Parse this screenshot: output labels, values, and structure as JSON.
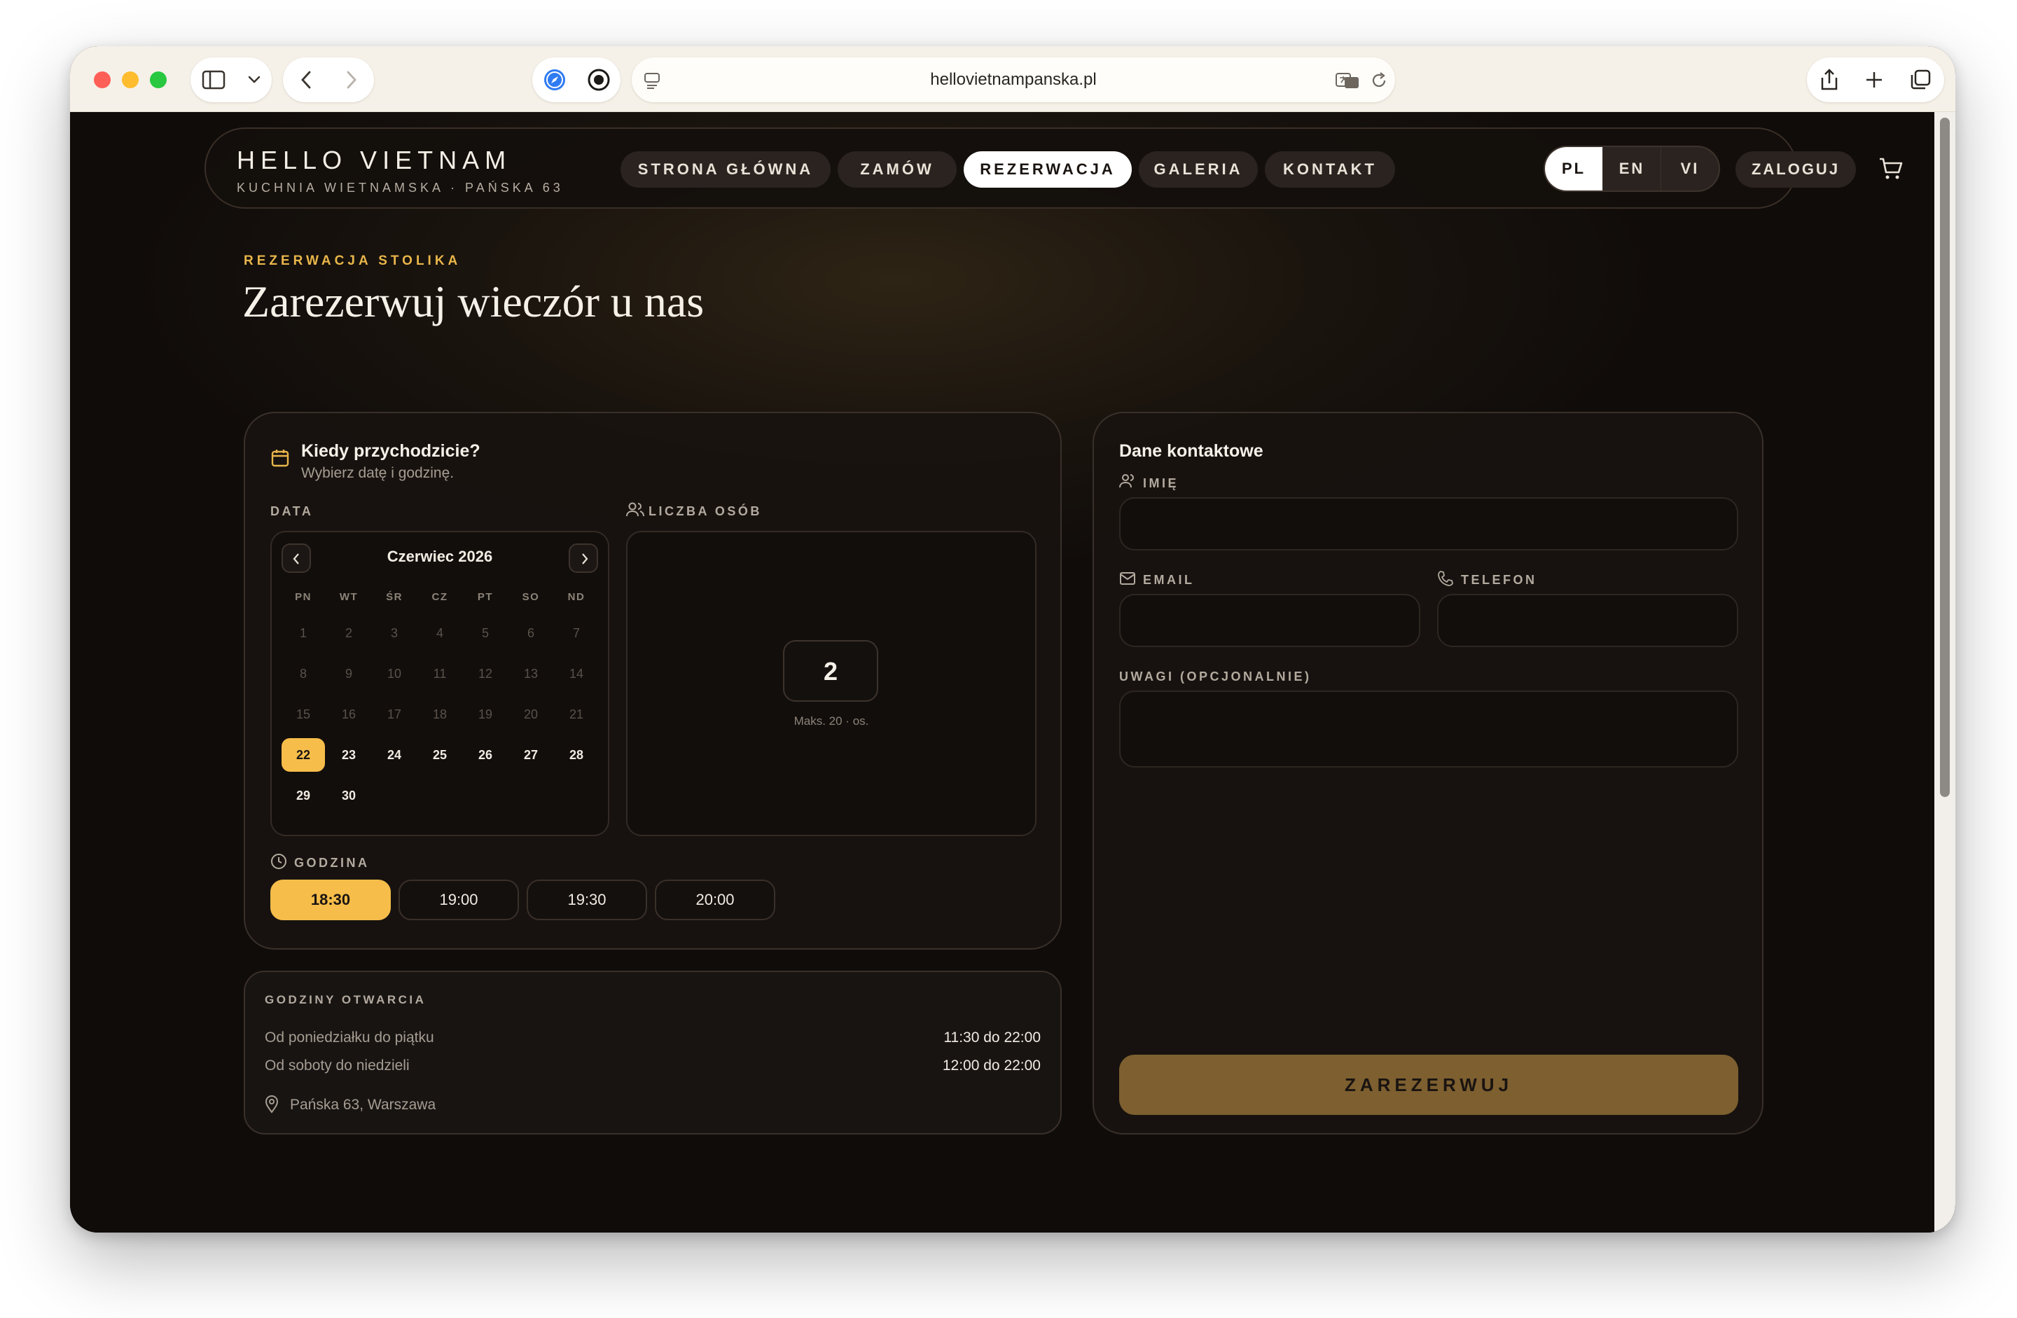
{
  "browser": {
    "url": "hellovietnampanska.pl"
  },
  "brand": {
    "name": "HELLO VIETNAM",
    "tagline": "KUCHNIA WIETNAMSKA · PAŃSKA 63"
  },
  "nav": {
    "items": [
      {
        "label": "STRONA GŁÓWNA",
        "active": false
      },
      {
        "label": "ZAMÓW",
        "active": false
      },
      {
        "label": "REZERWACJA",
        "active": true
      },
      {
        "label": "GALERIA",
        "active": false
      },
      {
        "label": "KONTAKT",
        "active": false
      }
    ],
    "languages": [
      "PL",
      "EN",
      "VI"
    ],
    "active_language": "PL",
    "login": "ZALOGUJ"
  },
  "hero": {
    "eyebrow": "REZERWACJA STOLIKA",
    "title": "Zarezerwuj wieczór u nas"
  },
  "when": {
    "title": "Kiedy przychodzicie?",
    "subtitle": "Wybierz datę i godzinę.",
    "date_label": "DATA",
    "guests_label": "LICZBA OSÓB",
    "time_label": "GODZINA",
    "calendar": {
      "month": "Czerwiec 2026",
      "weekdays": [
        "PN",
        "WT",
        "ŚR",
        "CZ",
        "PT",
        "SO",
        "ND"
      ],
      "days": [
        [
          "1",
          "2",
          "3",
          "4",
          "5",
          "6",
          "7"
        ],
        [
          "8",
          "9",
          "10",
          "11",
          "12",
          "13",
          "14"
        ],
        [
          "15",
          "16",
          "17",
          "18",
          "19",
          "20",
          "21"
        ],
        [
          "22",
          "23",
          "24",
          "25",
          "26",
          "27",
          "28"
        ],
        [
          "29",
          "30"
        ]
      ],
      "selected": "22",
      "first_available": "22"
    },
    "guests": {
      "value": "2",
      "max_note": "Maks. 20 · os."
    },
    "times": [
      "18:30",
      "19:00",
      "19:30",
      "20:00"
    ],
    "selected_time": "18:30"
  },
  "hours": {
    "title": "GODZINY OTWARCIA",
    "rows": [
      {
        "label": "Od poniedziałku do piątku",
        "value": "11:30 do 22:00"
      },
      {
        "label": "Od soboty do niedzieli",
        "value": "12:00 do 22:00"
      }
    ],
    "address": "Pańska 63, Warszawa"
  },
  "contact": {
    "title": "Dane kontaktowe",
    "name_label": "IMIĘ",
    "email_label": "EMAIL",
    "phone_label": "TELEFON",
    "notes_label": "UWAGI (OPCJONALNIE)",
    "name_value": "",
    "email_value": "",
    "phone_value": "",
    "notes_value": "",
    "submit": "ZAREZERWUJ"
  },
  "colors": {
    "accent": "#f6bd4a",
    "submit": "#7d5f30",
    "background": "#100c0a"
  }
}
